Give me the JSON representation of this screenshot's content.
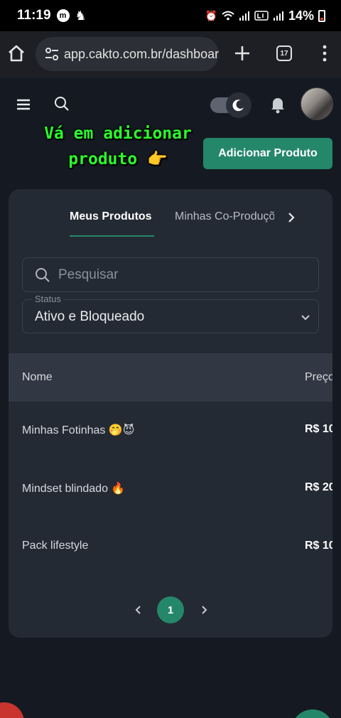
{
  "status_bar": {
    "time": "11:19",
    "notif_badge": "m",
    "battery_percent": "14%"
  },
  "browser": {
    "url": "app.cakto.com.br/dashboard",
    "tab_count": "17"
  },
  "annotation": {
    "line1": "Vá em adicionar",
    "line2": "produto 👉"
  },
  "header": {
    "add_product_label": "Adicionar Produto"
  },
  "tabs": [
    {
      "label": "Meus Produtos",
      "active": true
    },
    {
      "label": "Minhas Co-Produções",
      "active": false
    }
  ],
  "search": {
    "placeholder": "Pesquisar"
  },
  "status_filter": {
    "label": "Status",
    "value": "Ativo e Bloqueado"
  },
  "table": {
    "columns": [
      "Nome",
      "Preço"
    ],
    "rows": [
      {
        "name": "Minhas Fotinhas 🤭😈",
        "price": "R$ 10"
      },
      {
        "name": "Mindset blindado 🔥",
        "price": "R$ 20"
      },
      {
        "name": "Pack lifestyle",
        "price": "R$ 10"
      }
    ]
  },
  "pagination": {
    "current_page": "1"
  },
  "colors": {
    "accent": "#25876a",
    "background": "#151a22",
    "card": "#242a34",
    "annotation": "#2bff2b"
  }
}
